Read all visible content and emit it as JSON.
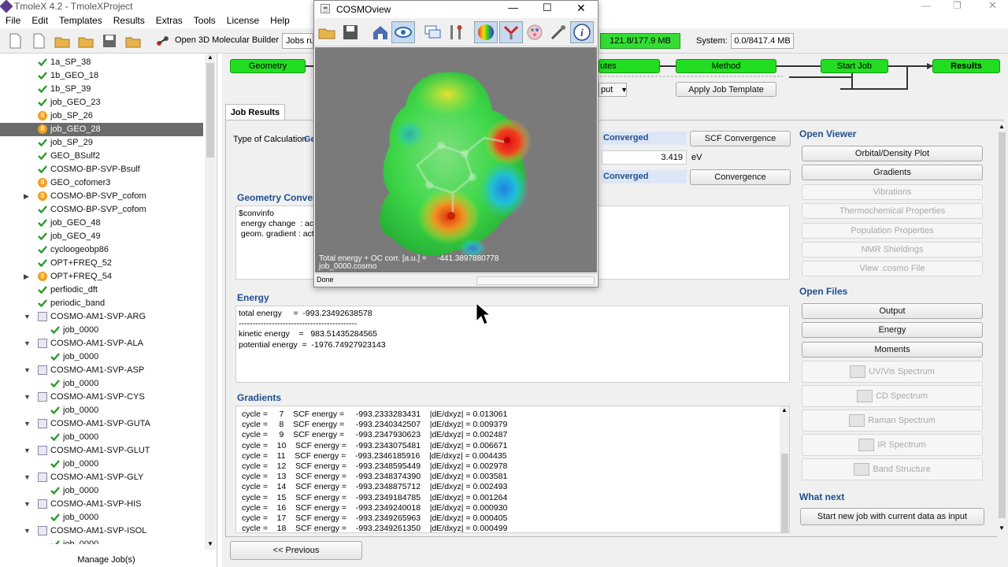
{
  "app_title": "TmoleX 4.2 - TmoleXProject",
  "menu": [
    "File",
    "Edit",
    "Templates",
    "Results",
    "Extras",
    "Tools",
    "License",
    "Help"
  ],
  "toolbar": {
    "builder_label": "Open 3D Molecular Builder",
    "jobs_label": "Jobs ru",
    "memory": "121.8/177.9 MB",
    "system_label": "System:",
    "system_value": "0.0/8417.4 MB"
  },
  "tree": [
    {
      "label": "1a_SP_38",
      "status": "ok",
      "indent": 1
    },
    {
      "label": "1b_GEO_18",
      "status": "ok",
      "indent": 1
    },
    {
      "label": "1b_SP_39",
      "status": "ok",
      "indent": 1
    },
    {
      "label": "job_GEO_23",
      "status": "ok",
      "indent": 1
    },
    {
      "label": "job_SP_26",
      "status": "paused",
      "indent": 1
    },
    {
      "label": "job_GEO_28",
      "status": "paused",
      "indent": 1,
      "selected": true
    },
    {
      "label": "job_SP_29",
      "status": "ok",
      "indent": 1
    },
    {
      "label": "GEO_BSulf2",
      "status": "ok",
      "indent": 1
    },
    {
      "label": "COSMO-BP-SVP-Bsulf",
      "status": "ok",
      "indent": 1
    },
    {
      "label": "GEO_cofomer3",
      "status": "paused",
      "indent": 1
    },
    {
      "label": "COSMO-BP-SVP_cofom",
      "status": "paused",
      "indent": 1,
      "expander": true
    },
    {
      "label": "COSMO-BP-SVP_cofom",
      "status": "ok",
      "indent": 1
    },
    {
      "label": "job_GEO_48",
      "status": "ok",
      "indent": 1
    },
    {
      "label": "job_GEO_49",
      "status": "ok",
      "indent": 1
    },
    {
      "label": "cycloogeobp86",
      "status": "ok",
      "indent": 1
    },
    {
      "label": "OPT+FREQ_52",
      "status": "ok",
      "indent": 1
    },
    {
      "label": "OPT+FREQ_54",
      "status": "paused",
      "indent": 1,
      "expander": true
    },
    {
      "label": "perfiodic_dft",
      "status": "ok",
      "indent": 1
    },
    {
      "label": "periodic_band",
      "status": "ok",
      "indent": 1
    },
    {
      "label": "COSMO-AM1-SVP-ARG",
      "status": "group",
      "indent": 1,
      "expander": true
    },
    {
      "label": "job_0000",
      "status": "ok",
      "indent": 2
    },
    {
      "label": "COSMO-AM1-SVP-ALA",
      "status": "group",
      "indent": 1,
      "expander": true
    },
    {
      "label": "job_0000",
      "status": "ok",
      "indent": 2
    },
    {
      "label": "COSMO-AM1-SVP-ASP",
      "status": "group",
      "indent": 1,
      "expander": true
    },
    {
      "label": "job_0000",
      "status": "ok",
      "indent": 2
    },
    {
      "label": "COSMO-AM1-SVP-CYS",
      "status": "group",
      "indent": 1,
      "expander": true
    },
    {
      "label": "job_0000",
      "status": "ok",
      "indent": 2
    },
    {
      "label": "COSMO-AM1-SVP-GUTA",
      "status": "group",
      "indent": 1,
      "expander": true
    },
    {
      "label": "job_0000",
      "status": "ok",
      "indent": 2
    },
    {
      "label": "COSMO-AM1-SVP-GLUT",
      "status": "group",
      "indent": 1,
      "expander": true
    },
    {
      "label": "job_0000",
      "status": "ok",
      "indent": 2
    },
    {
      "label": "COSMO-AM1-SVP-GLY",
      "status": "group",
      "indent": 1,
      "expander": true
    },
    {
      "label": "job_0000",
      "status": "ok",
      "indent": 2
    },
    {
      "label": "COSMO-AM1-SVP-HIS",
      "status": "group",
      "indent": 1,
      "expander": true
    },
    {
      "label": "job_0000",
      "status": "ok",
      "indent": 2
    },
    {
      "label": "COSMO-AM1-SVP-ISOL",
      "status": "group",
      "indent": 1,
      "expander": true
    },
    {
      "label": "job_0000",
      "status": "ok",
      "indent": 2
    }
  ],
  "manage_jobs": "Manage Job(s)",
  "workflow": {
    "geometry": "Geometry",
    "attributes": "utes",
    "method": "Method",
    "start_job": "Start Job",
    "results": "Results",
    "input_label": "put",
    "apply_template": "Apply Job Template"
  },
  "tab_label": "Job Results",
  "calc": {
    "type_label": "Type of Calculation",
    "type_value": "Ge",
    "converged1": "Converged",
    "scf_convergence_btn": "SCF Convergence",
    "gap_value": "3.419",
    "gap_unit": "eV",
    "converged2": "Converged",
    "convergence_btn": "Convergence"
  },
  "geom_conv": {
    "title": "Geometry Converg",
    "lines": [
      "$convinfo",
      " energy change  : act",
      " geom. gradient : act"
    ]
  },
  "energy": {
    "title": "Energy",
    "lines": [
      "total energy     =  -993.23492638578",
      "-------------------------------------------",
      "kinetic energy    =   983.51435284565",
      "potential energy  =  -1976.74927923143"
    ]
  },
  "gradients": {
    "title": "Gradients",
    "lines": [
      "cycle =     7    SCF energy =     -993.2333283431    |dE/dxyz| = 0.013061",
      "cycle =     8    SCF energy =     -993.2340342507    |dE/dxyz| = 0.009379",
      "cycle =     9    SCF energy =     -993.2347930623    |dE/dxyz| = 0.002487",
      "cycle =    10    SCF energy =    -993.2343075481    |dE/dxyz| = 0.006671",
      "cycle =    11    SCF energy =    -993.2346185916    |dE/dxyz| = 0.004435",
      "cycle =    12    SCF energy =    -993.2348595449    |dE/dxyz| = 0.002978",
      "cycle =    13    SCF energy =    -993.2348374390    |dE/dxyz| = 0.003581",
      "cycle =    14    SCF energy =    -993.2348875712    |dE/dxyz| = 0.002493",
      "cycle =    15    SCF energy =    -993.2349184785    |dE/dxyz| = 0.001264",
      "cycle =    16    SCF energy =    -993.2349240018    |dE/dxyz| = 0.000930",
      "cycle =    17    SCF energy =    -993.2349265963    |dE/dxyz| = 0.000405",
      "cycle =    18    SCF energy =    -993.2349261350    |dE/dxyz| = 0.000499"
    ]
  },
  "previous_btn": "<< Previous",
  "open_viewer": {
    "title": "Open Viewer",
    "buttons": [
      {
        "label": "Orbital/Density Plot",
        "enabled": true
      },
      {
        "label": "Gradients",
        "enabled": true
      },
      {
        "label": "Vibrations",
        "enabled": false
      },
      {
        "label": "Thermochemical Properties",
        "enabled": false
      },
      {
        "label": "Population Properties",
        "enabled": false
      },
      {
        "label": "NMR Shieldings",
        "enabled": false
      },
      {
        "label": "View .cosmo File",
        "enabled": false
      }
    ]
  },
  "open_files": {
    "title": "Open Files",
    "buttons": [
      {
        "label": "Output",
        "enabled": true
      },
      {
        "label": "Energy",
        "enabled": true
      },
      {
        "label": "Moments",
        "enabled": true
      },
      {
        "label": "UV/Vis Spectrum",
        "enabled": false
      },
      {
        "label": "CD Spectrum",
        "enabled": false
      },
      {
        "label": "Raman Spectrum",
        "enabled": false
      },
      {
        "label": "IR Spectrum",
        "enabled": false
      },
      {
        "label": "Band Structure",
        "enabled": false
      }
    ]
  },
  "what_next": {
    "title": "What next",
    "button": "Start new job with current data as input"
  },
  "cosmo": {
    "title": "COSMOview",
    "energy_label": "Total energy + OC corr. [a.u.] =",
    "energy_value": "-441.3897880778",
    "file": "job_0000.cosmo",
    "status": "Done"
  }
}
